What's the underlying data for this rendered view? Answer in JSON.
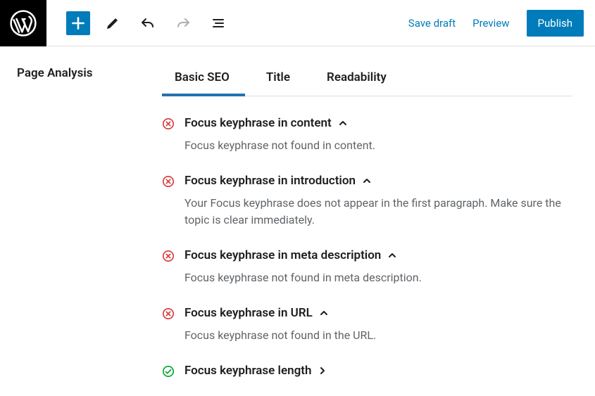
{
  "header": {
    "save_draft": "Save draft",
    "preview": "Preview",
    "publish": "Publish"
  },
  "sidebar_heading": "Page Analysis",
  "tabs": [
    {
      "label": "Basic SEO",
      "active": true
    },
    {
      "label": "Title",
      "active": false
    },
    {
      "label": "Readability",
      "active": false
    }
  ],
  "analysis_items": [
    {
      "status": "error",
      "title": "Focus keyphrase in content",
      "expanded": true,
      "description": "Focus keyphrase not found in content."
    },
    {
      "status": "error",
      "title": "Focus keyphrase in introduction",
      "expanded": true,
      "description": "Your Focus keyphrase does not appear in the first paragraph. Make sure the topic is clear immediately."
    },
    {
      "status": "error",
      "title": "Focus keyphrase in meta description",
      "expanded": true,
      "description": "Focus keyphrase not found in meta description."
    },
    {
      "status": "error",
      "title": "Focus keyphrase in URL",
      "expanded": true,
      "description": "Focus keyphrase not found in the URL."
    },
    {
      "status": "ok",
      "title": "Focus keyphrase length",
      "expanded": false,
      "description": ""
    }
  ],
  "colors": {
    "primary": "#007cba",
    "error": "#d63638",
    "ok": "#00a32a"
  }
}
